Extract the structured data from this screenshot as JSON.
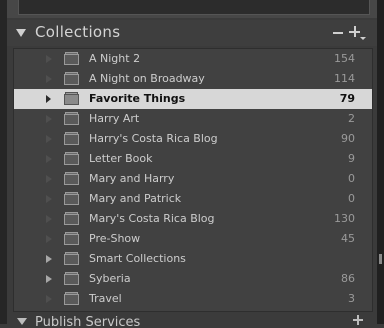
{
  "panel": {
    "title": "Collections",
    "remove_label": "−",
    "add_label": "+"
  },
  "items": [
    {
      "name": "A Night 2",
      "count": "154",
      "type": "collection",
      "selected": false,
      "expander": "dim"
    },
    {
      "name": "A Night on Broadway",
      "count": "114",
      "type": "collection",
      "selected": false,
      "expander": "dim"
    },
    {
      "name": "Favorite Things",
      "count": "79",
      "type": "collection",
      "selected": true,
      "expander": "dim"
    },
    {
      "name": "Harry Art",
      "count": "2",
      "type": "collection",
      "selected": false,
      "expander": "dim"
    },
    {
      "name": "Harry's Costa Rica Blog",
      "count": "90",
      "type": "collection",
      "selected": false,
      "expander": "dim"
    },
    {
      "name": "Letter Book",
      "count": "9",
      "type": "collection",
      "selected": false,
      "expander": "dim"
    },
    {
      "name": "Mary and Harry",
      "count": "0",
      "type": "collection",
      "selected": false,
      "expander": "dim"
    },
    {
      "name": "Mary and Patrick",
      "count": "0",
      "type": "collection",
      "selected": false,
      "expander": "dim"
    },
    {
      "name": "Mary's Costa Rica Blog",
      "count": "130",
      "type": "collection",
      "selected": false,
      "expander": "dim"
    },
    {
      "name": "Pre-Show",
      "count": "45",
      "type": "collection",
      "selected": false,
      "expander": "dim"
    },
    {
      "name": "Smart Collections",
      "count": "",
      "type": "collection-set",
      "selected": false,
      "expander": "on"
    },
    {
      "name": "Syberia",
      "count": "86",
      "type": "collection",
      "selected": false,
      "expander": "on"
    },
    {
      "name": "Travel",
      "count": "3",
      "type": "collection",
      "selected": false,
      "expander": "dim"
    }
  ],
  "next_panel": {
    "title": "Publish Services"
  },
  "colors": {
    "panel_bg": "#3b3b3b",
    "list_bg": "#414141",
    "selected_bg": "#d7d7d7",
    "text": "#cdcdcd",
    "count_text": "#9a9a9a"
  }
}
